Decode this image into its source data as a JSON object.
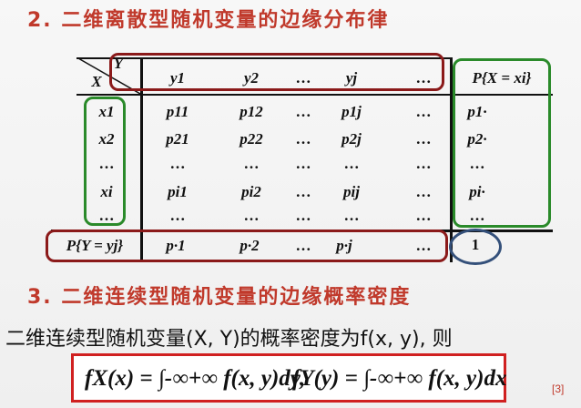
{
  "heading2": "2. 二维离散型随机变量的边缘分布律",
  "table": {
    "corner_top": "Y",
    "corner_bottom": "X",
    "col_headers": [
      "y1",
      "y2",
      "…",
      "yj",
      "…"
    ],
    "row_headers": [
      "x1",
      "x2",
      "…",
      "xi",
      "…"
    ],
    "cells": [
      [
        "p11",
        "p12",
        "…",
        "p1j",
        "…"
      ],
      [
        "p21",
        "p22",
        "…",
        "p2j",
        "…"
      ],
      [
        "…",
        "…",
        "…",
        "…",
        "…"
      ],
      [
        "pi1",
        "pi2",
        "…",
        "pij",
        "…"
      ],
      [
        "…",
        "…",
        "…",
        "…",
        "…"
      ]
    ],
    "right_header": "P{X = xi}",
    "right_col": [
      "p1·",
      "p2·",
      "…",
      "pi·",
      "…"
    ],
    "bottom_header": "P{Y = yj}",
    "bottom_row": [
      "p·1",
      "p·2",
      "…",
      "p·j",
      "…"
    ],
    "total": "1"
  },
  "heading3": "3. 二维连续型随机变量的边缘概率密度",
  "sentence": "二维连续型随机变量(X, Y)的概率密度为f(x, y), 则",
  "formula": {
    "left": "fX(x) = ∫-∞+∞ f(x, y)dy,",
    "right": "fY(y) = ∫-∞+∞ f(x, y)dx"
  },
  "citation": "[3]",
  "colors": {
    "heading": "#c0392b",
    "red_box": "#8b1a1a",
    "green_box": "#2a8a2a",
    "circle": "#34507a"
  }
}
